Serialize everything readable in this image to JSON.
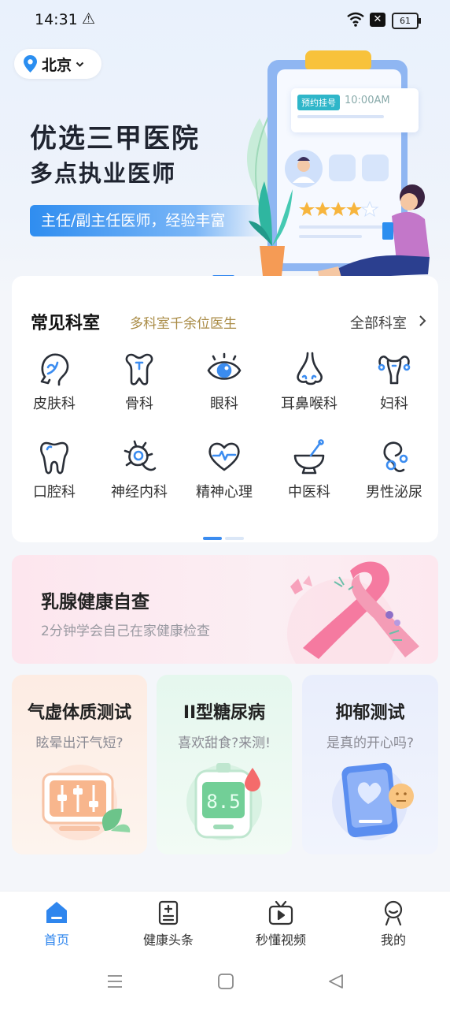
{
  "status": {
    "time": "14:31",
    "battery": "61"
  },
  "location": {
    "city": "北京"
  },
  "banner": {
    "title1": "优选三甲医院",
    "title2": "多点执业医师",
    "pill": "主任/副主任医师，经验丰富",
    "mini_tag": "预约挂号",
    "mini_time": "10:00AM"
  },
  "departments": {
    "title": "常见科室",
    "subtitle": "多科室千余位医生",
    "all_label": "全部科室",
    "items": [
      {
        "label": "皮肤科",
        "icon": "face-icon"
      },
      {
        "label": "骨科",
        "icon": "bone-icon"
      },
      {
        "label": "眼科",
        "icon": "eye-icon"
      },
      {
        "label": "耳鼻喉科",
        "icon": "nose-icon"
      },
      {
        "label": "妇科",
        "icon": "uterus-icon"
      },
      {
        "label": "口腔科",
        "icon": "tooth-icon"
      },
      {
        "label": "神经内科",
        "icon": "neuron-icon"
      },
      {
        "label": "精神心理",
        "icon": "heart-pulse-icon"
      },
      {
        "label": "中医科",
        "icon": "mortar-icon"
      },
      {
        "label": "男性泌尿",
        "icon": "male-urology-icon"
      }
    ]
  },
  "breast_banner": {
    "title": "乳腺健康自查",
    "subtitle": "2分钟学会自己在家健康检查"
  },
  "tests": [
    {
      "title": "气虚体质测试",
      "subtitle": "眩晕出汗气短?"
    },
    {
      "title": "II型糖尿病",
      "subtitle": "喜欢甜食?来测!",
      "reading": "8.5"
    },
    {
      "title": "抑郁测试",
      "subtitle": "是真的开心吗?"
    }
  ],
  "nav": {
    "items": [
      {
        "label": "首页",
        "active": true
      },
      {
        "label": "健康头条",
        "active": false
      },
      {
        "label": "秒懂视频",
        "active": false
      },
      {
        "label": "我的",
        "active": false
      }
    ]
  },
  "colors": {
    "accent": "#2f86ee",
    "gold": "#a98b45"
  }
}
